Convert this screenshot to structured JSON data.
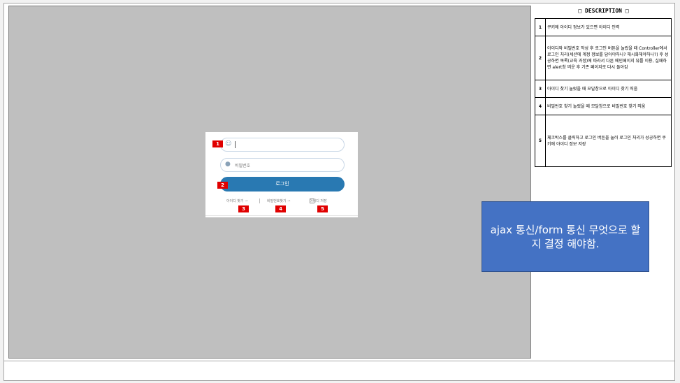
{
  "login": {
    "id_placeholder": "",
    "pw_placeholder": "비밀번호",
    "login_label": "로그인",
    "find_id": "아이디 찾기",
    "find_pw": "비밀번호찾기",
    "save_id": "아이디 저장"
  },
  "badges": [
    "1",
    "2",
    "3",
    "4",
    "5"
  ],
  "description": {
    "title": "□ DESCRIPTION □",
    "rows": [
      {
        "num": "1",
        "text": "쿠키에 아이디 정보가 있으면 아이디 인력"
      },
      {
        "num": "2",
        "text": "아이디와 비밀번호 작성 후 로그인 버튼을 눌렀을 때 Controller에서 로그인 처리(세션에 계정 정보를 담아야하나? 해시화해야하나?) 후 성공하면 목록(교육 과정)에 따라서 다른 메인페이지 뷰를 이용, 실패하면 alert창 띄운 후 기존 페이지로 다시 돌아감"
      },
      {
        "num": "3",
        "text": "아이디 찾기 눌렀을 때 모달창으로 아이디 찾기 띄움"
      },
      {
        "num": "4",
        "text": "비밀번호 찾기 눌렀을 때 모달창으로 비밀번호 찾기 띄움"
      },
      {
        "num": "5",
        "text": "체크박스를 클릭하고 로그인 버튼을 눌러 로그인 처리가 성공하면 쿠키에 아이디 정보 저장"
      }
    ]
  },
  "callout": "ajax 통신/form 통신 무엇으로 할지 결정 해야함.",
  "colors": {
    "accent": "#2979b2",
    "badge": "#e00000",
    "callout": "#4472c4"
  }
}
